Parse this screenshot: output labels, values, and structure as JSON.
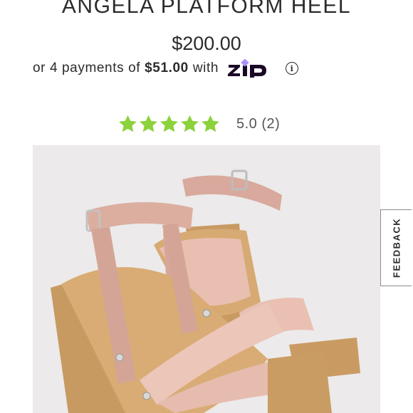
{
  "product": {
    "title": "ANGELA PLATFORM HEEL",
    "price": "$200.00"
  },
  "payments": {
    "prefix": "or 4 payments of",
    "amount": "$51.00",
    "suffix": "with",
    "provider_logo": "Zip",
    "info_icon": "info-icon"
  },
  "rating": {
    "stars_filled": 5,
    "stars_total": 5,
    "star_color": "#8bd23c",
    "score": "5.0",
    "count": "(2)"
  },
  "image": {
    "description_icon": "product-photo"
  },
  "feedback": {
    "label": "FEEDBACK"
  }
}
